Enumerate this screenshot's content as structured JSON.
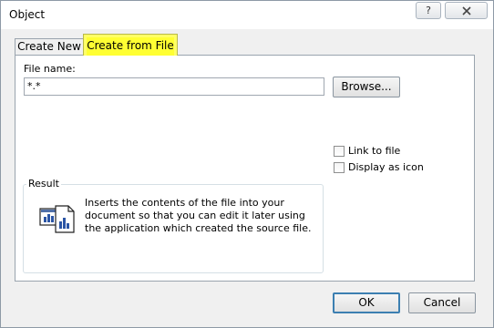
{
  "window": {
    "title": "Object",
    "help_label": "?"
  },
  "tabs": [
    {
      "label": "Create New",
      "active": false
    },
    {
      "label": "Create from File",
      "active": true,
      "highlight_color": "#ffff33"
    }
  ],
  "file": {
    "label": "File name:",
    "value": "*.*",
    "browse_label": "Browse..."
  },
  "options": {
    "link_label": "Link to file",
    "link_checked": false,
    "display_icon_label": "Display as icon",
    "display_icon_checked": false
  },
  "result": {
    "title": "Result",
    "text": "Inserts the contents of the file into your document so that you can edit it later using the application which created the source file."
  },
  "buttons": {
    "ok_label": "OK",
    "cancel_label": "Cancel"
  },
  "colors": {
    "accent": "#3c7fb1",
    "tab_highlight": "#ffff33"
  }
}
